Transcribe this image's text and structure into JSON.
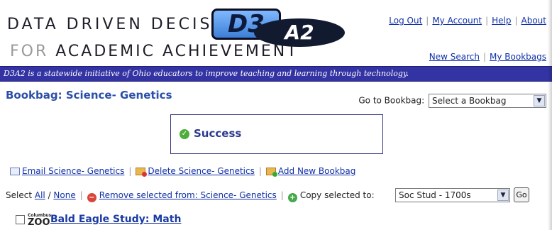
{
  "header": {
    "logo_line1": "DATA DRIVEN DECISIONS",
    "logo_line2_light": "FOR",
    "logo_line2_dark": "ACADEMIC ACHIEVEMENT",
    "badge_d3": "D3",
    "badge_a2": "A2",
    "top_links": [
      "Log Out",
      "My Account",
      "Help",
      "About"
    ],
    "sub_links": [
      "New Search",
      "My Bookbags"
    ]
  },
  "banner": {
    "text": "D3A2 is a statewide initiative of Ohio educators to improve teaching and learning through technology."
  },
  "bookbag": {
    "title": "Bookbag: Science- Genetics",
    "goto_label": "Go to Bookbag:",
    "goto_selected": "Select a Bookbag"
  },
  "status": {
    "message": "Success",
    "color": "#4fae3a"
  },
  "actions": {
    "email": "Email Science- Genetics",
    "delete": "Delete Science- Genetics",
    "add": "Add New Bookbag"
  },
  "selectbar": {
    "select_label": "Select",
    "all": "All",
    "none": "None",
    "remove": "Remove selected from: Science- Genetics",
    "copy_label": "Copy selected to:",
    "copy_selected": "Soc Stud - 1700s",
    "go": "Go"
  },
  "items": [
    {
      "title": "Bald Eagle Study: Math",
      "logo_top": "Columbus",
      "logo_big": "ZOO",
      "desc": ""
    }
  ],
  "colors": {
    "banner_bg": "#3333a3",
    "link": "#1030a8",
    "title": "#2b4fa8"
  }
}
